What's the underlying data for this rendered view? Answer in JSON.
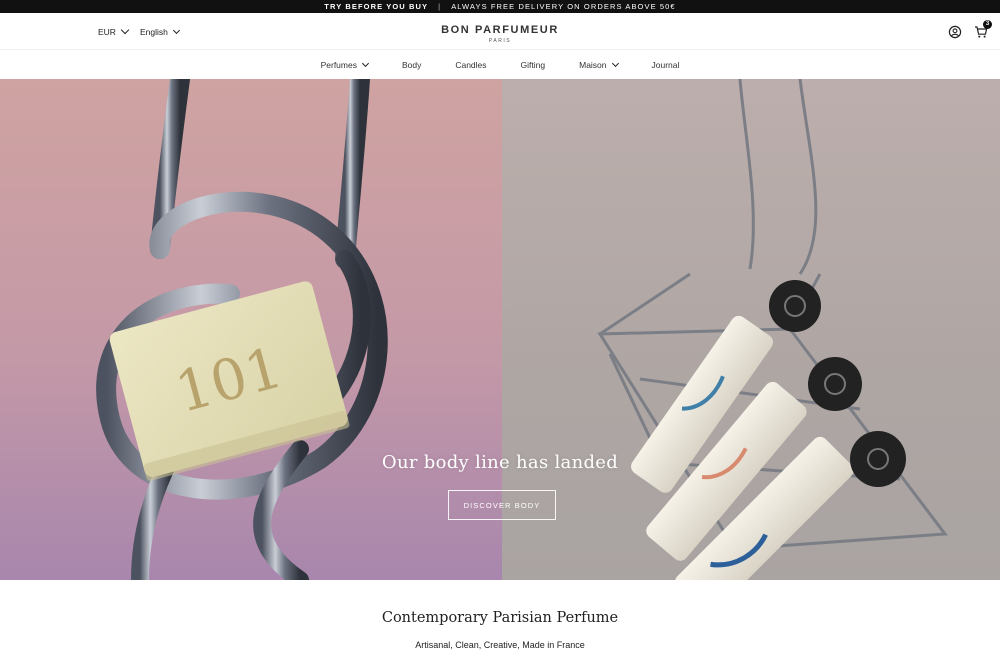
{
  "announcement": {
    "primary": "TRY BEFORE YOU BUY",
    "separator": "|",
    "secondary": "ALWAYS FREE DELIVERY ON ORDERS ABOVE 50€"
  },
  "header": {
    "currency": "EUR",
    "language": "English",
    "brand": "BON PARFUMEUR",
    "brand_city": "PARIS",
    "account_icon": "user-icon",
    "cart_icon": "cart-icon",
    "cart_count": "3"
  },
  "nav": {
    "items": [
      {
        "label": "Perfumes",
        "has_dropdown": true
      },
      {
        "label": "Body",
        "has_dropdown": false
      },
      {
        "label": "Candles",
        "has_dropdown": false
      },
      {
        "label": "Gifting",
        "has_dropdown": false
      },
      {
        "label": "Maison",
        "has_dropdown": true
      },
      {
        "label": "Journal",
        "has_dropdown": false
      }
    ]
  },
  "hero": {
    "headline": "Our body line has landed",
    "cta": "DISCOVER BODY",
    "soap_text": "101"
  },
  "intro": {
    "title": "Contemporary Parisian Perfume",
    "subtitle": "Artisanal, Clean, Creative, Made in France"
  },
  "colors": {
    "announcement_bg": "#111111",
    "hero_left": "#c79ca6",
    "hero_right": "#b2a8a6",
    "accent_dark": "#111111"
  }
}
